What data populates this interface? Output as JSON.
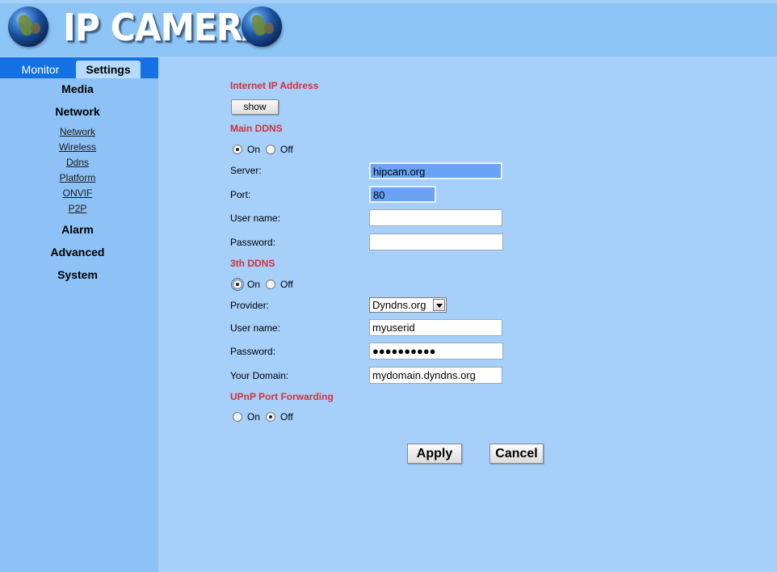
{
  "header": {
    "logo_text": "IP CAMERA",
    "icons": [
      "globe-icon",
      "globe-icon"
    ]
  },
  "tabs": [
    {
      "label": "Monitor",
      "active": false
    },
    {
      "label": "Settings",
      "active": true
    }
  ],
  "sidebar": {
    "sections": [
      {
        "label": "Media"
      },
      {
        "label": "Network",
        "items": [
          "Network",
          "Wireless",
          "Ddns",
          "Platform",
          "ONVIF",
          "P2P"
        ]
      },
      {
        "label": "Alarm"
      },
      {
        "label": "Advanced"
      },
      {
        "label": "System"
      }
    ]
  },
  "internet_ip": {
    "title": "Internet IP Address",
    "show_button": "show"
  },
  "main_ddns": {
    "title": "Main DDNS",
    "on_label": "On",
    "off_label": "Off",
    "selected": "On",
    "server_label": "Server:",
    "server_value": "hipcam.org",
    "port_label": "Port:",
    "port_value": "80",
    "username_label": "User name:",
    "username_value": "",
    "password_label": "Password:",
    "password_value": ""
  },
  "third_ddns": {
    "title": "3th DDNS",
    "on_label": "On",
    "off_label": "Off",
    "selected": "On",
    "provider_label": "Provider:",
    "provider_value": "Dyndns.org",
    "username_label": "User name:",
    "username_value": "myuserid",
    "password_label": "Password:",
    "password_value": "●●●●●●●●●●",
    "domain_label": "Your Domain:",
    "domain_value": "mydomain.dyndns.org"
  },
  "upnp": {
    "title": "UPnP Port Forwarding",
    "on_label": "On",
    "off_label": "Off",
    "selected": "Off"
  },
  "actions": {
    "apply": "Apply",
    "cancel": "Cancel"
  },
  "colors": {
    "section_title": "#d2303a",
    "tab_bar": "#1471e4",
    "background": "#a6d0fa",
    "highlight_field": "#6aa2f5"
  }
}
